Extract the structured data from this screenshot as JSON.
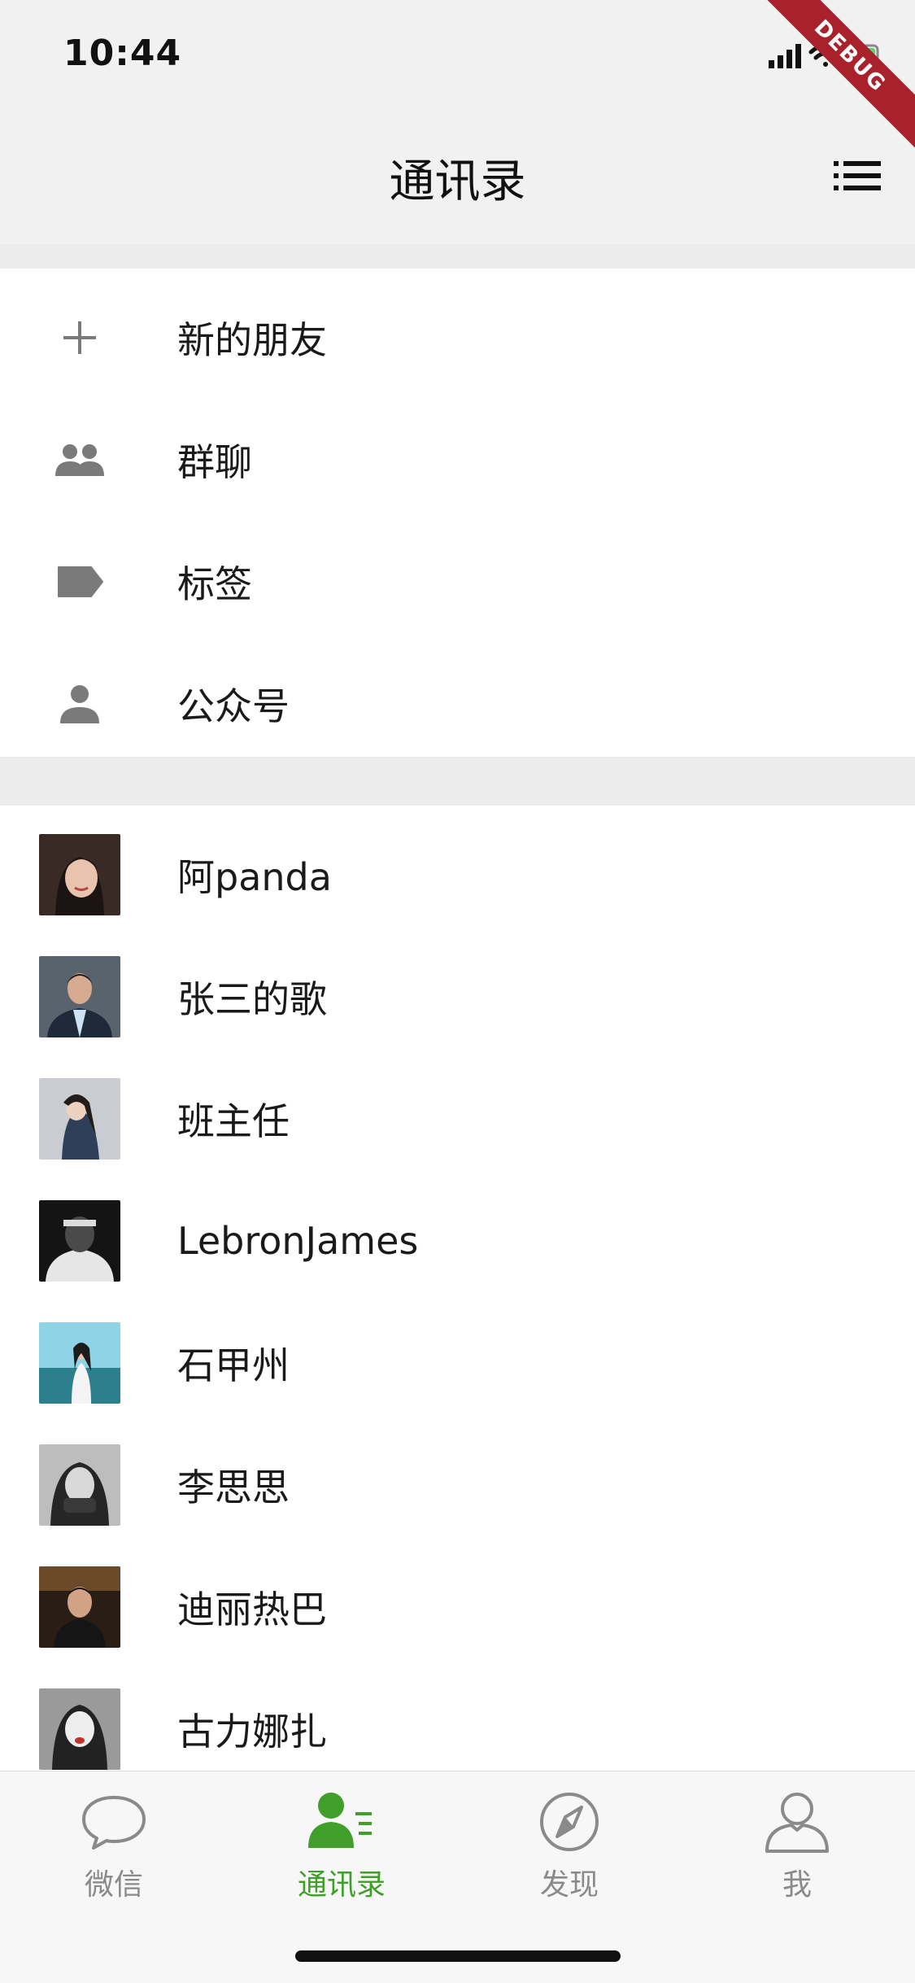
{
  "status_bar": {
    "time": "10:44"
  },
  "nav": {
    "title": "通讯录",
    "debug_banner": "DEBUG"
  },
  "menu_items": [
    {
      "label": "新的朋友",
      "icon": "plus-icon"
    },
    {
      "label": "群聊",
      "icon": "group-icon"
    },
    {
      "label": "标签",
      "icon": "tag-icon"
    },
    {
      "label": "公众号",
      "icon": "person-icon"
    }
  ],
  "contacts": [
    {
      "name": "阿panda"
    },
    {
      "name": "张三的歌"
    },
    {
      "name": "班主任"
    },
    {
      "name": "LebronJames"
    },
    {
      "name": "石甲州"
    },
    {
      "name": "李思思"
    },
    {
      "name": "迪丽热巴"
    },
    {
      "name": "古力娜扎"
    }
  ],
  "tabs": [
    {
      "label": "微信",
      "icon": "chat-bubble-icon",
      "active": false
    },
    {
      "label": "通讯录",
      "icon": "contacts-icon",
      "active": true
    },
    {
      "label": "发现",
      "icon": "compass-icon",
      "active": false
    },
    {
      "label": "我",
      "icon": "profile-icon",
      "active": false
    }
  ],
  "colors": {
    "accent_green": "#3f9f2a",
    "inactive_gray": "#8a8a8a",
    "header_bg": "#f1f1f1",
    "debug_red": "#a8212b"
  }
}
